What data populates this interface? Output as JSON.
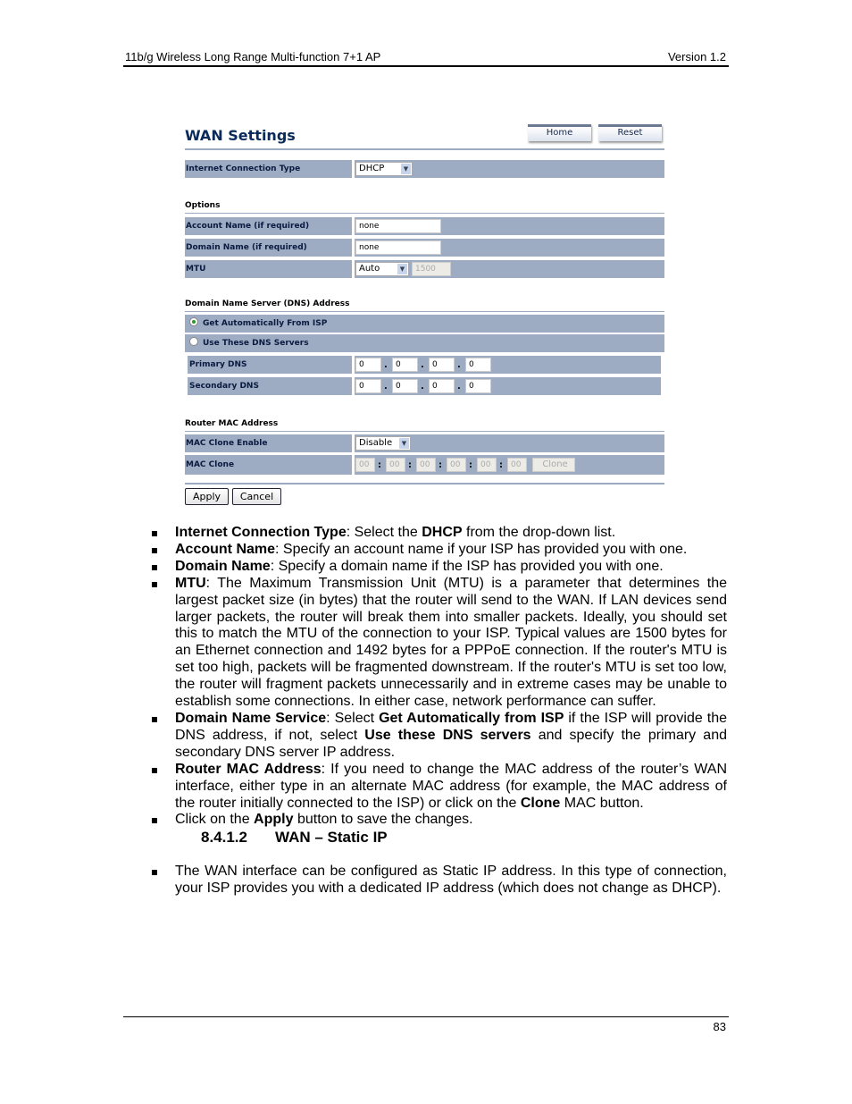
{
  "header": {
    "left": "11b/g Wireless Long Range Multi-function 7+1 AP",
    "right": "Version 1.2"
  },
  "ui": {
    "title": "WAN Settings",
    "home": "Home",
    "reset": "Reset",
    "ict_label": "Internet Connection Type",
    "ict_value": "DHCP",
    "options_heading": "Options",
    "account_label": "Account Name (if required)",
    "account_value": "none",
    "domain_label": "Domain Name (if required)",
    "domain_value": "none",
    "mtu_label": "MTU",
    "mtu_mode": "Auto",
    "mtu_value": "1500",
    "dns_heading": "Domain Name Server (DNS) Address",
    "dns_auto": "Get Automatically From ISP",
    "dns_manual": "Use These DNS Servers",
    "dns_selected": "auto",
    "primary_label": "Primary DNS",
    "primary": [
      "0",
      "0",
      "0",
      "0"
    ],
    "secondary_label": "Secondary DNS",
    "secondary": [
      "0",
      "0",
      "0",
      "0"
    ],
    "mac_heading": "Router MAC Address",
    "mac_enable_label": "MAC Clone Enable",
    "mac_enable_value": "Disable",
    "mac_clone_label": "MAC Clone",
    "mac": [
      "00",
      "00",
      "00",
      "00",
      "00",
      "00"
    ],
    "clone": "Clone",
    "apply": "Apply",
    "cancel": "Cancel"
  },
  "bullets": [
    {
      "b": "Internet Connection Type",
      "t1": ": Select the ",
      "b2": "DHCP",
      "t2": " from the drop-down list."
    },
    {
      "b": "Account Name",
      "t1": ": Specify an account name if your ISP has provided you with one."
    },
    {
      "b": "Domain Name",
      "t1": ": Specify a domain name if the ISP has provided you with one."
    },
    {
      "b": "MTU",
      "t1": ": The Maximum Transmission Unit (MTU) is a parameter that determines the largest packet size (in bytes) that the router will send to the WAN. If LAN devices send larger packets, the router will break them into smaller packets. Ideally, you should set this to match the MTU of the connection to your ISP. Typical values are 1500 bytes for an Ethernet connection and 1492 bytes for a PPPoE connection. If the router's MTU is set too high, packets will be fragmented downstream. If the router's MTU is set too low, the router will fragment packets unnecessarily and in extreme cases may be unable to establish some connections. In either case, network performance can suffer."
    },
    {
      "b": "Domain Name Service",
      "t1": ": Select ",
      "b2": "Get Automatically from ISP",
      "t2": " if the ISP will provide the DNS address, if not, select ",
      "b3": "Use these DNS servers",
      "t3": " and specify the primary and secondary DNS server IP address."
    },
    {
      "b": "Router MAC Address",
      "t1": ": If you need to change the MAC address of the router’s WAN interface, either type in an alternate MAC address (for example, the MAC address of the router initially connected to the ISP) or click on the ",
      "b2": "Clone",
      "t2": " MAC button."
    },
    {
      "t0": "Click on the ",
      "b": "Apply",
      "t1": " button to save the changes."
    }
  ],
  "section": {
    "number": "8.4.1.2",
    "title": "WAN – Static IP"
  },
  "static_bullet": "The WAN interface can be configured as Static IP address. In this type of connection, your ISP provides you with a dedicated IP address (which does not change as DHCP).",
  "footer": {
    "page": "83"
  }
}
